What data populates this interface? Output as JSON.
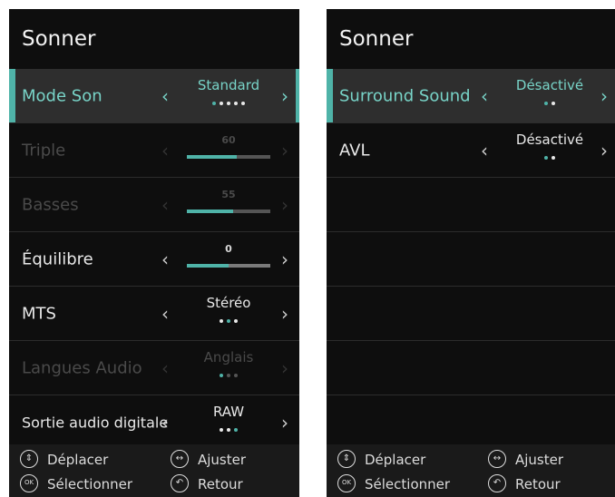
{
  "left": {
    "title": "Sonner",
    "rows": [
      {
        "label": "Mode Son",
        "value": "Standard",
        "dots": 5,
        "active": 0,
        "state": "selected"
      },
      {
        "label": "Triple",
        "value": "60",
        "slider": 0.6,
        "state": "disabled"
      },
      {
        "label": "Basses",
        "value": "55",
        "slider": 0.55,
        "state": "disabled"
      },
      {
        "label": "Équilibre",
        "value": "0",
        "slider": 0.5,
        "state": "normal"
      },
      {
        "label": "MTS",
        "value": "Stéréo",
        "dots": 3,
        "active": 1,
        "state": "normal"
      },
      {
        "label": "Langues Audio",
        "value": "Anglais",
        "dots": 3,
        "active": 0,
        "state": "disabled"
      },
      {
        "label": "Sortie audio digitale",
        "value": "RAW",
        "dots": 3,
        "active": 2,
        "state": "normal"
      }
    ]
  },
  "right": {
    "title": "Sonner",
    "rows": [
      {
        "label": "Surround Sound",
        "value": "Désactivé",
        "dots": 2,
        "active": 0,
        "state": "selected"
      },
      {
        "label": "AVL",
        "value": "Désactivé",
        "dots": 2,
        "active": 0,
        "state": "normal"
      }
    ]
  },
  "footer": {
    "move": "Déplacer",
    "adjust": "Ajuster",
    "select": "Sélectionner",
    "back": "Retour",
    "ok_glyph": "OK"
  },
  "arrows": {
    "left": "‹",
    "right": "›"
  },
  "colors": {
    "accent": "#4fb3a8",
    "background": "#0e0e0e"
  }
}
